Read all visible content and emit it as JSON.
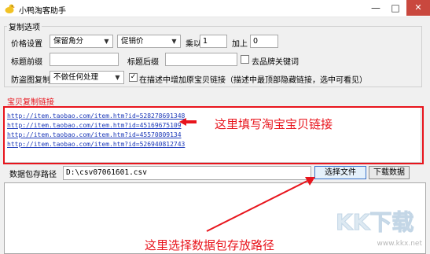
{
  "window": {
    "title": "小鸭淘客助手",
    "minimize_icon": "minimize-icon",
    "maximize_icon": "maximize-icon",
    "close_icon": "close-icon"
  },
  "copy_options": {
    "group_label": "复制选项",
    "price_label": "价格设置",
    "price_mode": "保留角分",
    "price_source": "促销价",
    "multiply_label": "乘以",
    "multiply_value": "1",
    "add_label": "加上",
    "add_value": "0",
    "title_prefix_label": "标题前缀",
    "title_prefix_value": "",
    "title_suffix_label": "标题后缀",
    "title_suffix_value": "",
    "remove_keywords_label": "去品牌关键词",
    "remove_keywords_checked": false,
    "anti_theft_label": "防盗图复制",
    "anti_theft_value": "不做任何处理",
    "add_link_label": "在描述中增加原宝贝链接（描述中最顶部隐藏链接，选中可看见）",
    "add_link_checked": true
  },
  "links_section": {
    "title": "宝贝复制链接",
    "links": [
      "http://item.taobao.com/item.htm?id=528278691348",
      "http://item.taobao.com/item.htm?id=45169675109",
      "http://item.taobao.com/item.htm?id=45570809134",
      "http://item.taobao.com/item.htm?id=526940812743"
    ]
  },
  "data_path": {
    "label": "数据包存路径",
    "value": "D:\\csv07061601.csv",
    "choose_file_button": "选择文件",
    "download_button": "下载数据"
  },
  "annotations": {
    "links_hint": "这里填写淘宝宝贝链接",
    "path_hint": "这里选择数据包存放路径",
    "color": "#e8141c"
  },
  "watermark": {
    "logo_text": "KK下载",
    "url": "www.kkx.net"
  }
}
